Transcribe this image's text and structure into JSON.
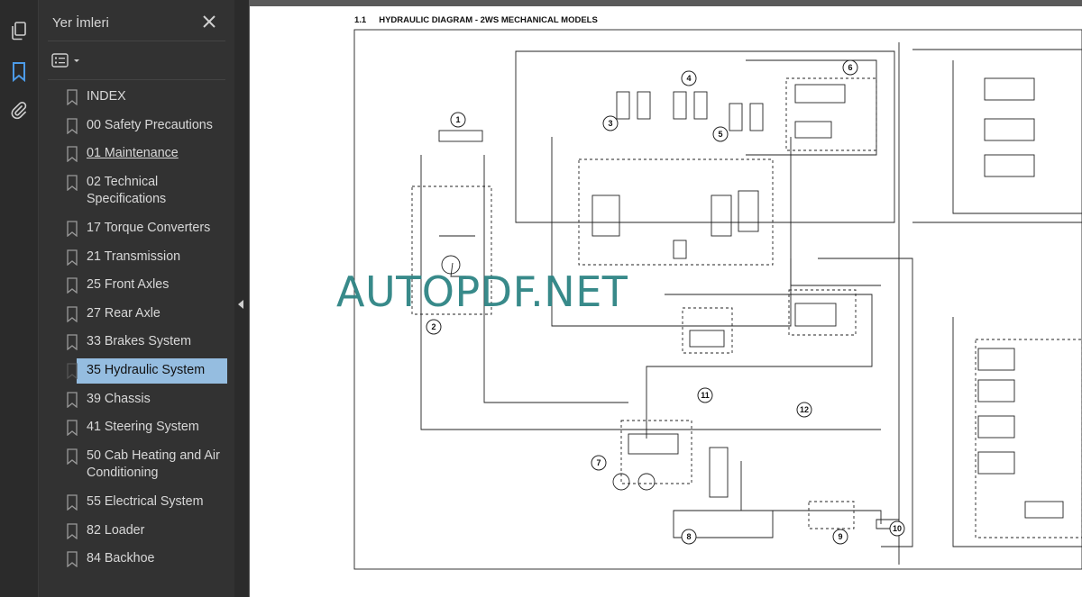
{
  "sidebar": {
    "title": "Yer İmleri",
    "rail_icons": [
      "pages-icon",
      "bookmark-icon",
      "attachment-icon"
    ],
    "bookmarks": [
      {
        "label": "INDEX",
        "underlined": false,
        "selected": false
      },
      {
        "label": "00 Safety Precautions",
        "underlined": false,
        "selected": false
      },
      {
        "label": "01 Maintenance",
        "underlined": true,
        "selected": false
      },
      {
        "label": "02 Technical Specifications",
        "underlined": false,
        "selected": false
      },
      {
        "label": "17 Torque Converters",
        "underlined": false,
        "selected": false
      },
      {
        "label": "21 Transmission",
        "underlined": false,
        "selected": false
      },
      {
        "label": "25 Front Axles",
        "underlined": false,
        "selected": false
      },
      {
        "label": "27 Rear Axle",
        "underlined": false,
        "selected": false
      },
      {
        "label": "33 Brakes System",
        "underlined": false,
        "selected": false
      },
      {
        "label": "35 Hydraulic System",
        "underlined": false,
        "selected": true
      },
      {
        "label": "39 Chassis",
        "underlined": false,
        "selected": false
      },
      {
        "label": "41 Steering System",
        "underlined": false,
        "selected": false
      },
      {
        "label": "50 Cab Heating and Air Conditioning",
        "underlined": false,
        "selected": false
      },
      {
        "label": "55 Electrical System",
        "underlined": false,
        "selected": false
      },
      {
        "label": "82 Loader",
        "underlined": false,
        "selected": false
      },
      {
        "label": "84 Backhoe",
        "underlined": false,
        "selected": false
      }
    ]
  },
  "document": {
    "section_number": "1.1",
    "section_title": "HYDRAULIC DIAGRAM - 2WS MECHANICAL MODELS",
    "watermark": "AUTOPDF.NET",
    "component_numbers": [
      "1",
      "2",
      "3",
      "4",
      "5",
      "6",
      "7",
      "8",
      "9",
      "10",
      "11",
      "12"
    ]
  },
  "colors": {
    "selected_bookmark": "#95bde0",
    "panel_bg": "#323232",
    "rail_bg": "#2b2b2b",
    "accent_icon": "#4c9be8",
    "watermark": "#2e8484"
  }
}
